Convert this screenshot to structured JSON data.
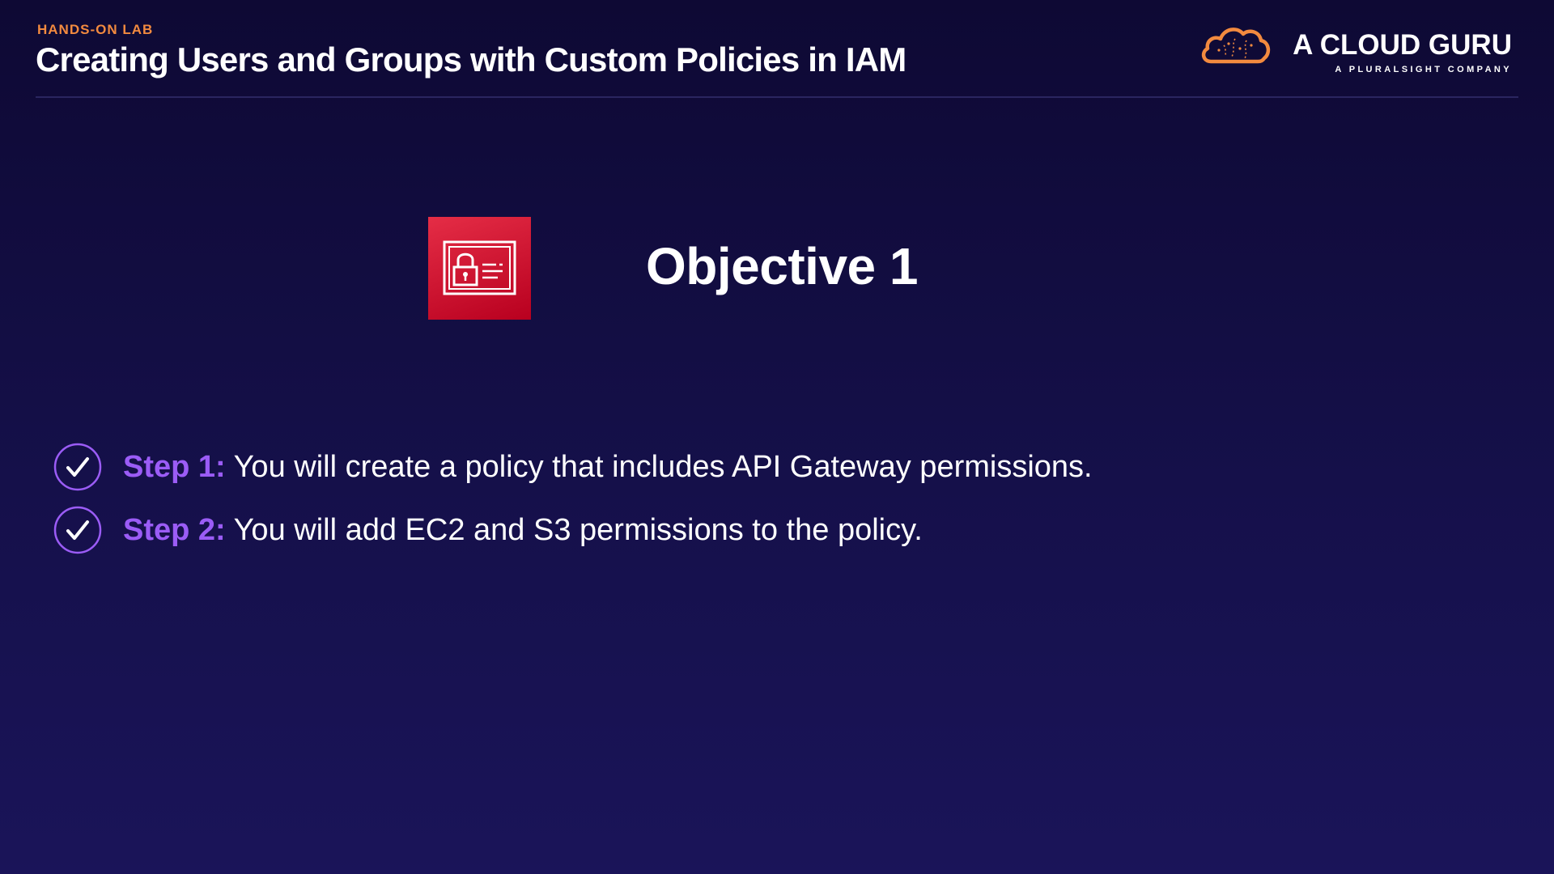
{
  "header": {
    "eyebrow": "HANDS-ON LAB",
    "title": "Creating Users and Groups with Custom Policies in IAM"
  },
  "brand": {
    "name": "A CLOUD GURU",
    "tagline": "A PLURALSIGHT COMPANY",
    "logo_icon": "cloud-logo-icon",
    "logo_color": "#f28a3f"
  },
  "objective": {
    "title": "Objective 1",
    "icon": "iam-identity-card-icon",
    "icon_color": "#d3172e"
  },
  "steps": [
    {
      "label": "Step 1:",
      "text": "You will create a policy that includes API Gateway permissions.",
      "icon": "check-circle-icon"
    },
    {
      "label": "Step 2:",
      "text": "You will add EC2 and S3 permissions to the policy.",
      "icon": "check-circle-icon"
    }
  ],
  "colors": {
    "background_top": "#0e0934",
    "background_bottom": "#1a1459",
    "accent_orange": "#f28a3f",
    "accent_purple": "#9b5cf6"
  }
}
